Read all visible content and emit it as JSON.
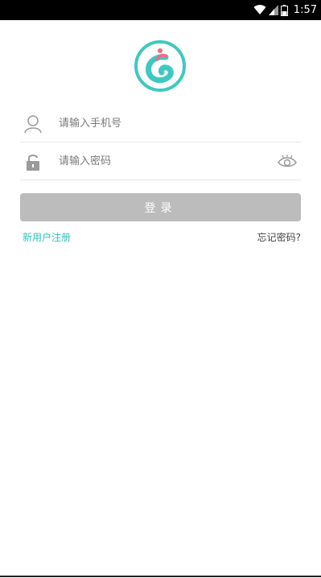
{
  "status_bar": {
    "time": "1:57",
    "icons": [
      "wifi-icon",
      "signal-icon",
      "battery-icon"
    ]
  },
  "logo": {
    "name": "app-logo",
    "ring_color": "#3fc8c2",
    "accent_color": "#f06a8a"
  },
  "phone_field": {
    "placeholder": "请输入手机号",
    "icon": "user-icon"
  },
  "password_field": {
    "placeholder": "请输入密码",
    "icon": "lock-icon",
    "toggle_icon": "eye-icon"
  },
  "login_button": {
    "label": "登录"
  },
  "links": {
    "register": "新用户注册",
    "forgot_password": "忘记密码?"
  },
  "colors": {
    "accent": "#2cc4c0",
    "button_disabled": "#bcbcbc"
  }
}
